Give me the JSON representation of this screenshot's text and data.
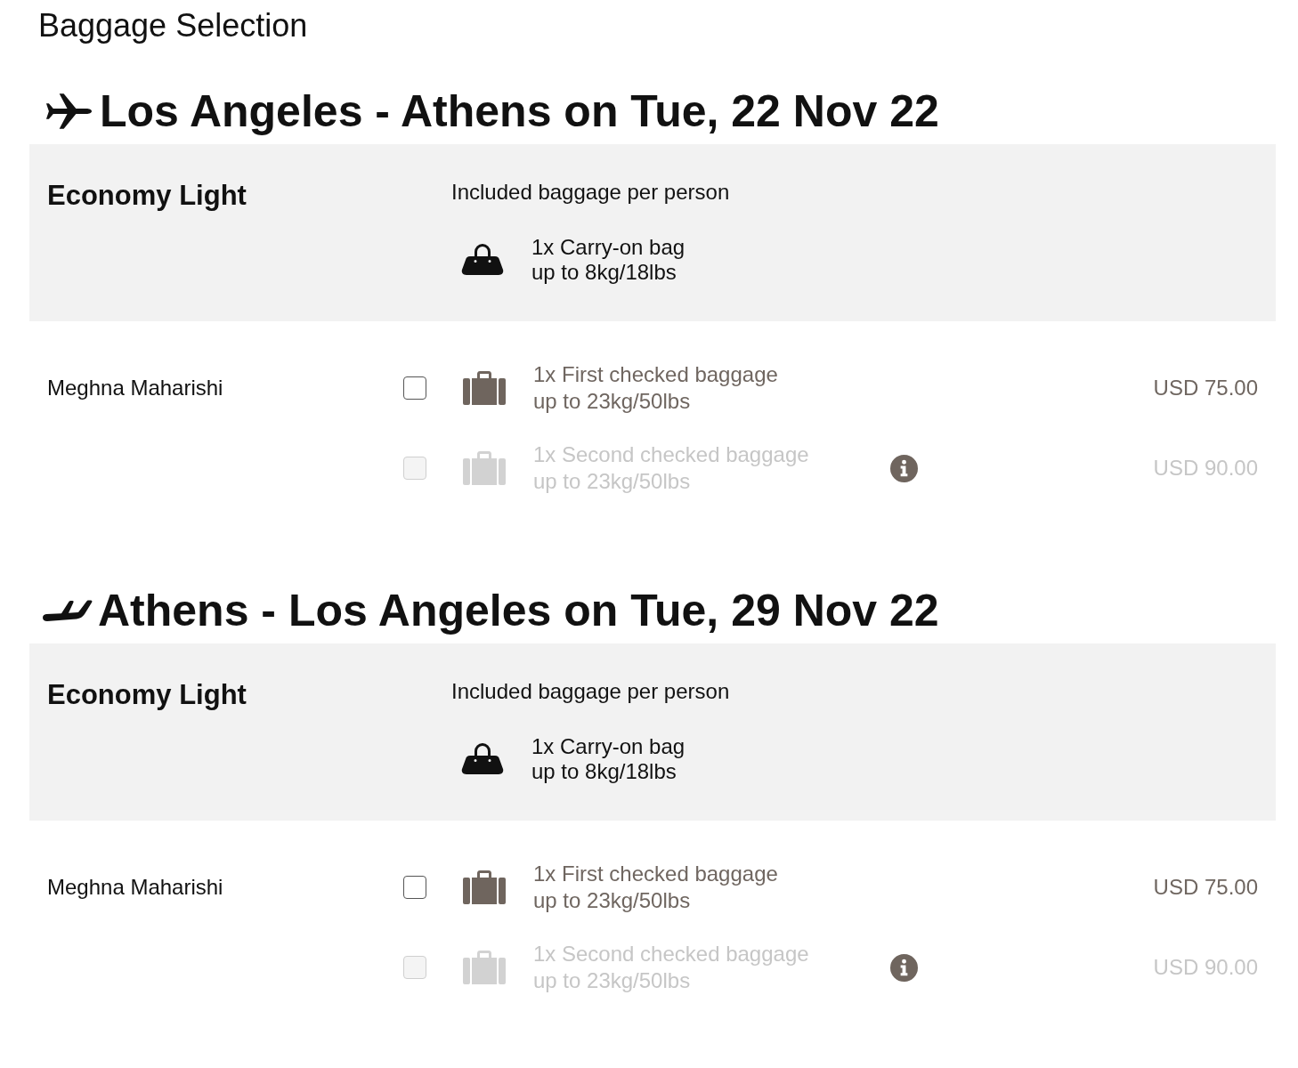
{
  "page": {
    "title": "Baggage Selection"
  },
  "flights": [
    {
      "kind": "departure",
      "heading": "Los Angeles - Athens on Tue, 22 Nov 22",
      "fare": {
        "name": "Economy Light",
        "included_label": "Included baggage per person",
        "included": [
          {
            "title": "1x Carry-on bag",
            "weight": "up to 8kg/18lbs"
          }
        ]
      },
      "passengers": [
        {
          "name": "Meghna Maharishi",
          "options": [
            {
              "title": "1x First checked baggage",
              "weight": "up to 23kg/50lbs",
              "price": "USD 75.00",
              "checked": false,
              "disabled": false,
              "info": false
            },
            {
              "title": "1x Second checked baggage",
              "weight": "up to 23kg/50lbs",
              "price": "USD 90.00",
              "checked": false,
              "disabled": true,
              "info": true
            }
          ]
        }
      ]
    },
    {
      "kind": "arrival",
      "heading": "Athens - Los Angeles on Tue, 29 Nov 22",
      "fare": {
        "name": "Economy Light",
        "included_label": "Included baggage per person",
        "included": [
          {
            "title": "1x Carry-on bag",
            "weight": "up to 8kg/18lbs"
          }
        ]
      },
      "passengers": [
        {
          "name": "Meghna Maharishi",
          "options": [
            {
              "title": "1x First checked baggage",
              "weight": "up to 23kg/50lbs",
              "price": "USD 75.00",
              "checked": false,
              "disabled": false,
              "info": false
            },
            {
              "title": "1x Second checked baggage",
              "weight": "up to 23kg/50lbs",
              "price": "USD 90.00",
              "checked": false,
              "disabled": true,
              "info": true
            }
          ]
        }
      ]
    }
  ]
}
